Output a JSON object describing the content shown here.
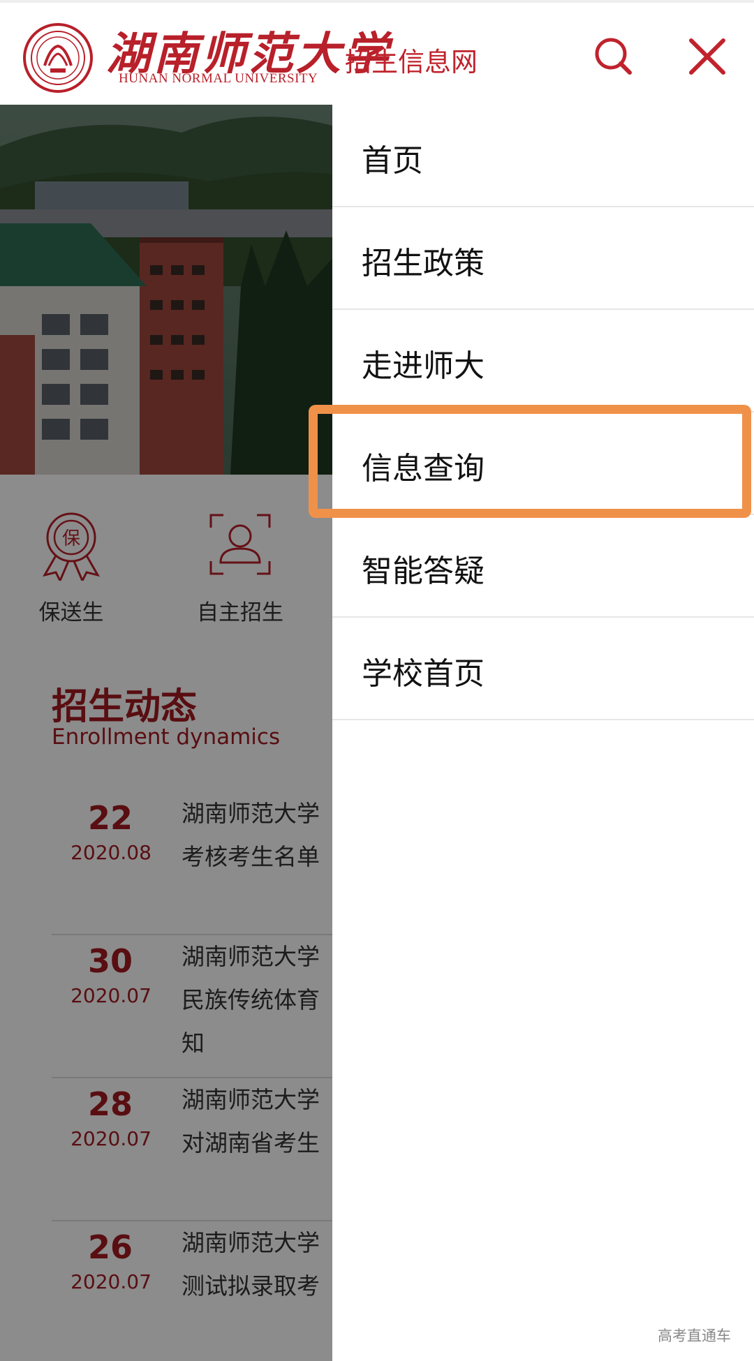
{
  "header": {
    "logo_cn": "湖南师范大学",
    "logo_en": "HUNAN NORMAL UNIVERSITY",
    "site_name": "招生信息网",
    "search_icon": "search-icon",
    "close_icon": "close-icon"
  },
  "colors": {
    "brand_red": "#b8202a",
    "highlight_orange": "#f0914a",
    "overlay": "rgba(0,0,0,0.45)"
  },
  "quick_links": [
    {
      "label": "保送生",
      "icon": "award-medal-icon",
      "icon_char": "保"
    },
    {
      "label": "自主招生",
      "icon": "person-scan-icon"
    }
  ],
  "news": {
    "title": "招生动态",
    "subtitle": "Enrollment dynamics",
    "items": [
      {
        "day": "22",
        "date": "2020.08",
        "text": "湖南师范大学\n考核考生名单"
      },
      {
        "day": "30",
        "date": "2020.07",
        "text": "湖南师范大学\n民族传统体育\n知"
      },
      {
        "day": "28",
        "date": "2020.07",
        "text": "湖南师范大学\n对湖南省考生"
      },
      {
        "day": "26",
        "date": "2020.07",
        "text": "湖南师范大学\n测试拟录取考"
      }
    ]
  },
  "menu": {
    "items": [
      {
        "label": "首页"
      },
      {
        "label": "招生政策"
      },
      {
        "label": "走进师大"
      },
      {
        "label": "信息查询",
        "highlighted": true
      },
      {
        "label": "智能答疑"
      },
      {
        "label": "学校首页"
      }
    ]
  },
  "watermark": "高考直通车"
}
